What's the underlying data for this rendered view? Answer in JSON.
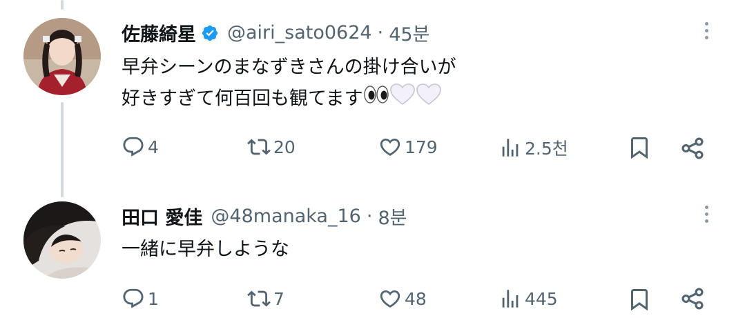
{
  "thread": {
    "tweets": [
      {
        "display_name": "佐藤綺星",
        "verified": true,
        "handle": "@airi_sato0624",
        "separator": "·",
        "time": "45분",
        "text_line1": "早弁シーンのまなずきさんの掛け合いが",
        "text_line2": "好きすぎて何百回も観てます",
        "emojis": [
          "eyes-emoji",
          "white-heart-emoji",
          "white-heart-emoji"
        ],
        "replies": "4",
        "retweets": "20",
        "likes": "179",
        "views": "2.5천"
      },
      {
        "display_name": "田口 愛佳",
        "verified": false,
        "handle": "@48manaka_16",
        "separator": "·",
        "time": "8분",
        "text_line1": "一緒に早弁しような",
        "replies": "1",
        "retweets": "7",
        "likes": "48",
        "views": "445"
      }
    ]
  },
  "colors": {
    "text": "#0f1419",
    "secondary": "#536471",
    "verified_blue": "#1d9bf0",
    "thread_line": "#cfd9de",
    "divider": "#eff3f4"
  },
  "icons": [
    "reply-icon",
    "retweet-icon",
    "like-icon",
    "views-icon",
    "bookmark-icon",
    "share-icon",
    "more-icon",
    "verified-badge-icon"
  ]
}
